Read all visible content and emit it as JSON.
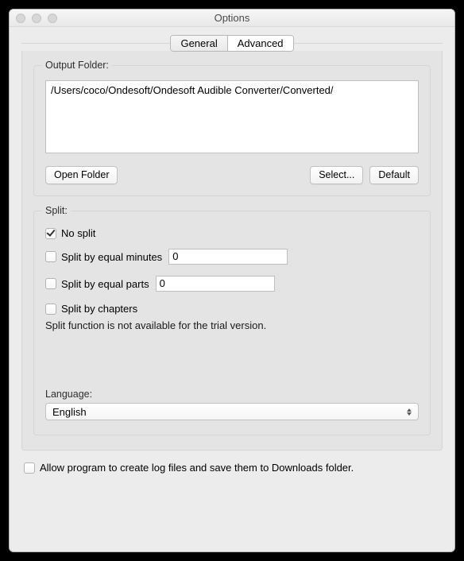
{
  "window": {
    "title": "Options"
  },
  "tabs": {
    "general": "General",
    "advanced": "Advanced"
  },
  "output": {
    "label": "Output Folder:",
    "path": "/Users/coco/Ondesoft/Ondesoft Audible Converter/Converted/",
    "open": "Open Folder",
    "select": "Select...",
    "default": "Default"
  },
  "split": {
    "label": "Split:",
    "no_split": "No split",
    "by_minutes": "Split by equal minutes",
    "minutes_value": "0",
    "by_parts": "Split by equal parts",
    "parts_value": "0",
    "by_chapters": "Split by chapters",
    "note": "Split function is not available for the trial version."
  },
  "language": {
    "label": "Language:",
    "value": "English"
  },
  "log": {
    "label": "Allow program to create log files and save them to Downloads folder."
  }
}
